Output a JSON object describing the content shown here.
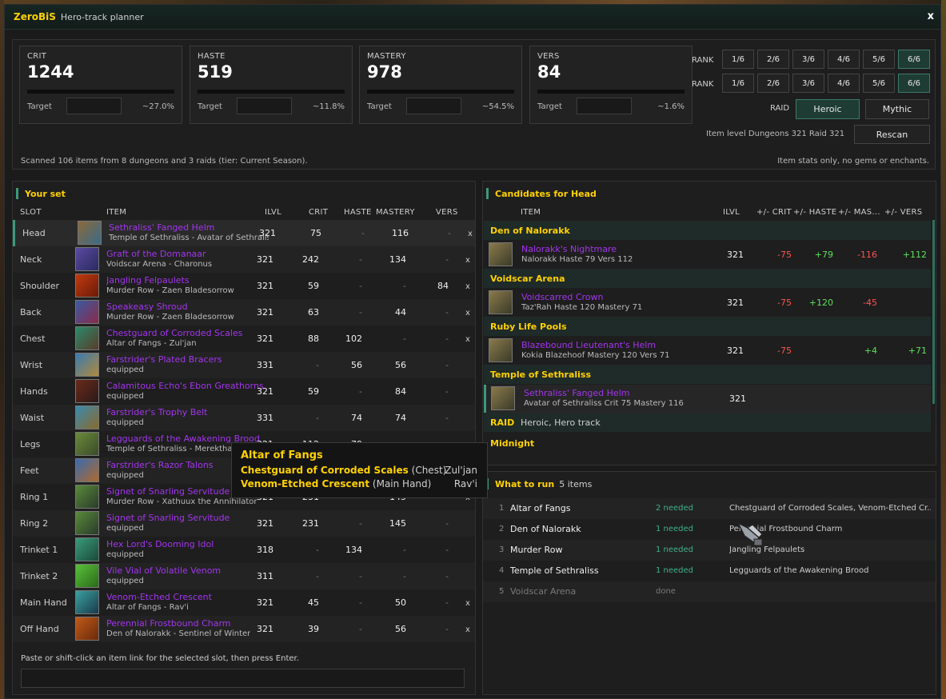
{
  "window": {
    "brand": "ZeroBiS",
    "title": "Hero-track planner",
    "close": "x"
  },
  "stats": [
    {
      "name": "CRIT",
      "value": "1244",
      "target_label": "Target",
      "pct": "~27.0%"
    },
    {
      "name": "HASTE",
      "value": "519",
      "target_label": "Target",
      "pct": "~11.8%"
    },
    {
      "name": "MASTERY",
      "value": "978",
      "target_label": "Target",
      "pct": "~54.5%"
    },
    {
      "name": "VERS",
      "value": "84",
      "target_label": "Target",
      "pct": "~1.6%"
    }
  ],
  "rank": {
    "label": "RANK",
    "row1": [
      "1/6",
      "2/6",
      "3/6",
      "4/6",
      "5/6",
      "6/6"
    ],
    "row2": [
      "1/6",
      "2/6",
      "3/6",
      "4/6",
      "5/6",
      "6/6"
    ],
    "selected": "6/6"
  },
  "raid": {
    "label": "RAID",
    "options": [
      "Heroic",
      "Mythic"
    ],
    "selected": "Heroic"
  },
  "item_level": {
    "text": "Item level  Dungeons 321  Raid 321",
    "rescan": "Rescan"
  },
  "scan_text": "Scanned 106 items from 8 dungeons and 3 raids (tier: Current Season).",
  "scan_note": "Item stats only, no gems or enchants.",
  "your_set": {
    "title": "Your set",
    "headers": {
      "slot": "SLOT",
      "item": "ITEM",
      "ilvl": "ILVL",
      "crit": "CRIT",
      "haste": "HASTE",
      "mastery": "MASTERY",
      "vers": "VERS"
    },
    "rows": [
      {
        "slot": "Head",
        "name": "Sethraliss' Fanged Helm",
        "src": "Temple of Sethraliss - Avatar of Sethraliss",
        "ilvl": "321",
        "crit": "75",
        "haste": "-",
        "mastery": "116",
        "vers": "-",
        "x": "x",
        "icon": "helm-icon",
        "c1": "#8a6a3a",
        "c2": "#3a6a8a"
      },
      {
        "slot": "Neck",
        "name": "Graft of the Domanaar",
        "src": "Voidscar Arena - Charonus",
        "ilvl": "321",
        "crit": "242",
        "haste": "-",
        "mastery": "134",
        "vers": "-",
        "x": "x",
        "icon": "neck-icon",
        "c1": "#5a4aa0",
        "c2": "#2a2a60"
      },
      {
        "slot": "Shoulder",
        "name": "Jangling Felpaulets",
        "src": "Murder Row - Zaen Bladesorrow",
        "ilvl": "321",
        "crit": "59",
        "haste": "-",
        "mastery": "-",
        "vers": "84",
        "x": "x",
        "icon": "shoulder-icon",
        "c1": "#c03a10",
        "c2": "#6a1a08"
      },
      {
        "slot": "Back",
        "name": "Speakeasy Shroud",
        "src": "Murder Row - Zaen Bladesorrow",
        "ilvl": "321",
        "crit": "63",
        "haste": "-",
        "mastery": "44",
        "vers": "-",
        "x": "x",
        "icon": "cloak-icon",
        "c1": "#3a5aa0",
        "c2": "#8a2a4a"
      },
      {
        "slot": "Chest",
        "name": "Chestguard of Corroded Scales",
        "src": "Altar of Fangs - Zul'jan",
        "ilvl": "321",
        "crit": "88",
        "haste": "102",
        "mastery": "-",
        "vers": "-",
        "x": "x",
        "icon": "chest-icon",
        "c1": "#2a8a6a",
        "c2": "#5a3a2a"
      },
      {
        "slot": "Wrist",
        "name": "Farstrider's Plated Bracers",
        "src": "equipped",
        "ilvl": "331",
        "crit": "-",
        "haste": "56",
        "mastery": "56",
        "vers": "-",
        "x": "",
        "icon": "bracer-icon",
        "c1": "#3a7ab0",
        "c2": "#b08a3a"
      },
      {
        "slot": "Hands",
        "name": "Calamitous Echo's Ebon Greathorns",
        "src": "equipped",
        "ilvl": "321",
        "crit": "59",
        "haste": "-",
        "mastery": "84",
        "vers": "-",
        "x": "",
        "icon": "gloves-icon",
        "c1": "#6a2a1a",
        "c2": "#2a1a1a"
      },
      {
        "slot": "Waist",
        "name": "Farstrider's Trophy Belt",
        "src": "equipped",
        "ilvl": "331",
        "crit": "-",
        "haste": "74",
        "mastery": "74",
        "vers": "-",
        "x": "",
        "icon": "belt-icon",
        "c1": "#3a8ab0",
        "c2": "#8a6a2a"
      },
      {
        "slot": "Legs",
        "name": "Legguards of the Awakening Brood",
        "src": "Temple of Sethraliss - Merektha",
        "ilvl": "321",
        "crit": "112",
        "haste": "79",
        "mastery": "-",
        "vers": "-",
        "x": "x",
        "icon": "legs-icon",
        "c1": "#6a8a3a",
        "c2": "#3a4a2a"
      },
      {
        "slot": "Feet",
        "name": "Farstrider's Razor Talons",
        "src": "equipped",
        "ilvl": "321",
        "crit": "-",
        "haste": "-",
        "mastery": "74",
        "vers": "-",
        "x": "",
        "icon": "boots-icon",
        "c1": "#3a6ab0",
        "c2": "#b06a2a"
      },
      {
        "slot": "Ring 1",
        "name": "Signet of Snarling Servitude",
        "src": "Murder Row - Xathuux the Annihilator",
        "ilvl": "321",
        "crit": "231",
        "haste": "-",
        "mastery": "145",
        "vers": "-",
        "x": "x",
        "icon": "ring-icon",
        "c1": "#5a8a3a",
        "c2": "#2a3a2a"
      },
      {
        "slot": "Ring 2",
        "name": "Signet of Snarling Servitude",
        "src": "equipped",
        "ilvl": "321",
        "crit": "231",
        "haste": "-",
        "mastery": "145",
        "vers": "-",
        "x": "",
        "icon": "ring-icon",
        "c1": "#5a8a3a",
        "c2": "#2a3a2a"
      },
      {
        "slot": "Trinket 1",
        "name": "Hex Lord's Dooming Idol",
        "src": "equipped",
        "ilvl": "318",
        "crit": "-",
        "haste": "134",
        "mastery": "-",
        "vers": "-",
        "x": "",
        "icon": "idol-icon",
        "c1": "#3a9a7a",
        "c2": "#1a4a3a"
      },
      {
        "slot": "Trinket 2",
        "name": "Vile Vial of Volatile Venom",
        "src": "equipped",
        "ilvl": "311",
        "crit": "-",
        "haste": "-",
        "mastery": "-",
        "vers": "-",
        "x": "",
        "icon": "vial-icon",
        "c1": "#5ac03a",
        "c2": "#2a6a1a"
      },
      {
        "slot": "Main Hand",
        "name": "Venom-Etched Crescent",
        "src": "Altar of Fangs - Rav'i",
        "ilvl": "321",
        "crit": "45",
        "haste": "-",
        "mastery": "50",
        "vers": "-",
        "x": "x",
        "icon": "weapon-icon",
        "c1": "#3aa0a0",
        "c2": "#1a3a4a"
      },
      {
        "slot": "Off Hand",
        "name": "Perennial Frostbound Charm",
        "src": "Den of Nalorakk - Sentinel of Winter",
        "ilvl": "321",
        "crit": "39",
        "haste": "-",
        "mastery": "56",
        "vers": "-",
        "x": "x",
        "icon": "charm-icon",
        "c1": "#c05a1a",
        "c2": "#6a2a0a"
      }
    ],
    "help": "Paste or shift-click an item link for the selected slot, then press Enter.",
    "input_value": ""
  },
  "candidates": {
    "title": "Candidates for Head",
    "headers": {
      "item": "ITEM",
      "ilvl": "ILVL",
      "crit": "+/- CRIT",
      "haste": "+/- HASTE",
      "mastery": "+/- MAS...",
      "vers": "+/- VERS"
    },
    "groups": [
      {
        "name": "Den of Nalorakk",
        "items": [
          {
            "name": "Nalorakk's Nightmare",
            "src": "Nalorakk   Haste 79  Vers 112",
            "ilvl": "321",
            "crit": "-75",
            "haste": "+79",
            "mastery": "-116",
            "vers": "+112",
            "icon": "skull-icon"
          }
        ]
      },
      {
        "name": "Voidscar Arena",
        "items": [
          {
            "name": "Voidscarred Crown",
            "src": "Taz'Rah   Haste 120  Mastery 71",
            "ilvl": "321",
            "crit": "-75",
            "haste": "+120",
            "mastery": "-45",
            "vers": "",
            "icon": "skull-icon"
          }
        ]
      },
      {
        "name": "Ruby Life Pools",
        "items": [
          {
            "name": "Blazebound Lieutenant's Helm",
            "src": "Kokia Blazehoof   Mastery 120  Vers 71",
            "ilvl": "321",
            "crit": "-75",
            "haste": "",
            "mastery": "+4",
            "vers": "+71",
            "icon": "helm-icon"
          }
        ]
      },
      {
        "name": "Temple of Sethraliss",
        "items": [
          {
            "name": "Sethraliss' Fanged Helm",
            "src": "Avatar of Sethraliss   Crit 75  Mastery 116",
            "ilvl": "321",
            "crit": "",
            "haste": "",
            "mastery": "",
            "vers": "",
            "icon": "helm-icon"
          }
        ]
      }
    ],
    "raid_group": {
      "label": "RAID",
      "sub": "Heroic, Hero track"
    },
    "midnight_group": {
      "name": "Midnight"
    }
  },
  "what_to_run": {
    "title": "What to run",
    "count": "5 items",
    "rows": [
      {
        "n": "1",
        "dungeon": "Altar of Fangs",
        "need": "2 needed",
        "items": "Chestguard of Corroded Scales, Venom-Etched Cr..."
      },
      {
        "n": "2",
        "dungeon": "Den of Nalorakk",
        "need": "1 needed",
        "items": "Perennial Frostbound Charm"
      },
      {
        "n": "3",
        "dungeon": "Murder Row",
        "need": "1 needed",
        "items": "Jangling Felpaulets"
      },
      {
        "n": "4",
        "dungeon": "Temple of Sethraliss",
        "need": "1 needed",
        "items": "Legguards of the Awakening Brood"
      },
      {
        "n": "5",
        "dungeon": "Voidscar Arena",
        "need": "done",
        "items": ""
      }
    ]
  },
  "tooltip": {
    "title": "Altar of Fangs",
    "lines": [
      {
        "item": "Chestguard of Corroded Scales",
        "slot": "(Chest)",
        "boss": "Zul'jan"
      },
      {
        "item": "Venom-Etched Crescent",
        "slot": "(Main Hand)",
        "boss": "Rav'i"
      }
    ]
  },
  "colors": {
    "epic": "#a335ee",
    "gold": "#ffd100",
    "accent": "#3c9a7c",
    "negative": "#ff5252",
    "positive": "#5ee05e"
  }
}
